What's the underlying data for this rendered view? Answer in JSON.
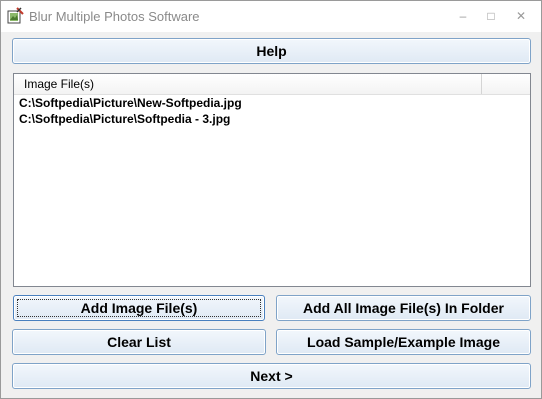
{
  "window": {
    "title": "Blur Multiple Photos Software",
    "controls": {
      "minimize": "–",
      "maximize": "□",
      "close": "✕"
    }
  },
  "help_button": "Help",
  "file_list": {
    "column_header": "Image File(s)",
    "rows": [
      "C:\\Softpedia\\Picture\\New-Softpedia.jpg",
      "C:\\Softpedia\\Picture\\Softpedia - 3.jpg"
    ]
  },
  "buttons": {
    "add_files": "Add Image File(s)",
    "add_folder": "Add All Image File(s) In Folder",
    "clear_list": "Clear List",
    "load_sample": "Load Sample/Example Image",
    "next": "Next >"
  },
  "icons": {
    "app": "blur-photo-app-icon",
    "minimize": "minimize-icon",
    "maximize": "maximize-icon",
    "close": "close-icon"
  },
  "colors": {
    "button_border": "#7fa3c8",
    "button_face": "#e6eef7",
    "window_bg": "#f0f0f0"
  }
}
